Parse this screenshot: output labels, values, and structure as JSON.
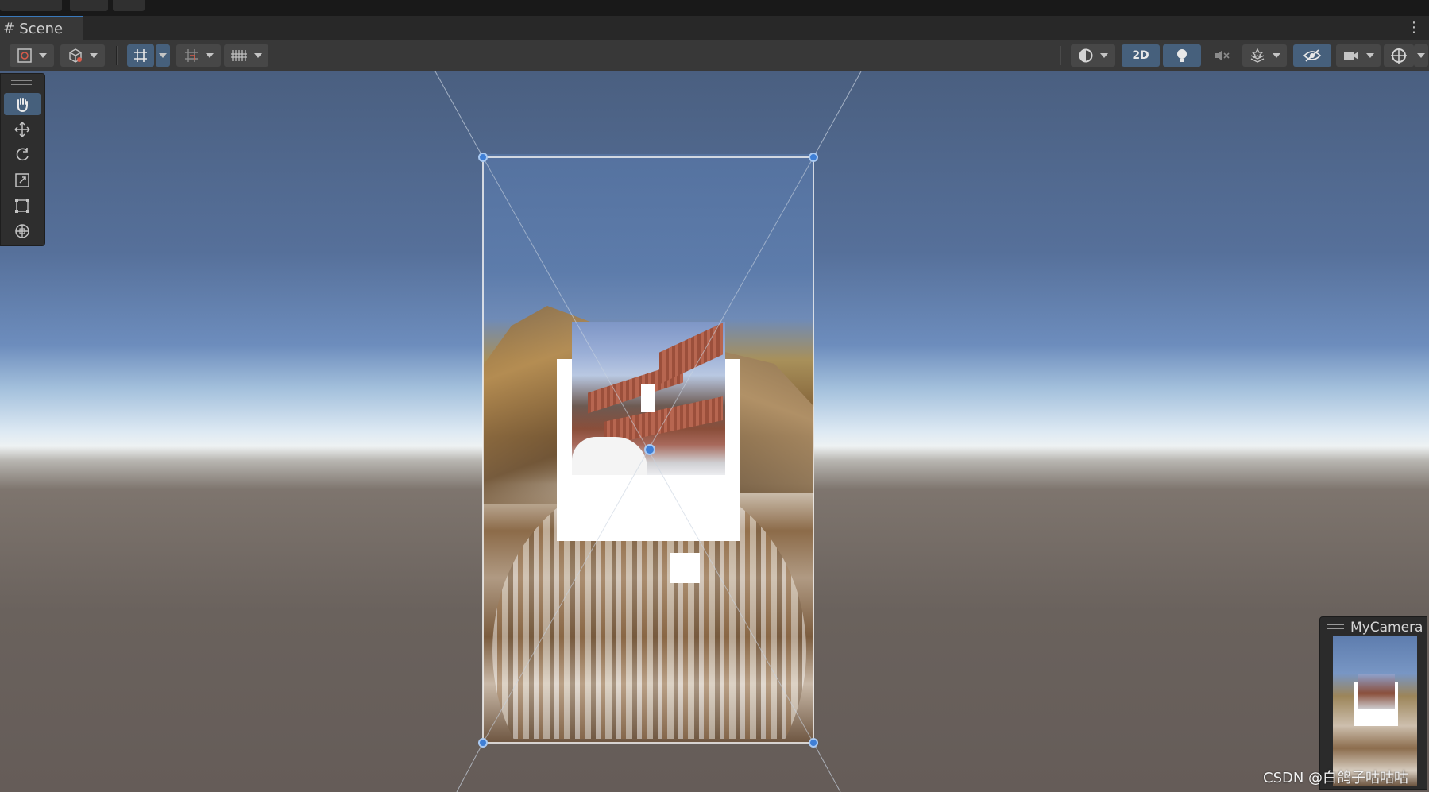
{
  "window": {
    "scene_tab_label": "Scene"
  },
  "toolbar": {
    "mode_2d_label": "2D",
    "icons": [
      "gizmo-draw-mode-icon",
      "render-mode-icon",
      "grid-snapping-icon",
      "increment-snapping-icon",
      "grid-visibility-icon",
      "shading-mode-icon",
      "2d-toggle",
      "lighting-toggle-icon",
      "audio-toggle-icon",
      "effects-icon",
      "hidden-objects-icon",
      "camera-settings-icon",
      "gizmos-icon"
    ]
  },
  "tools": {
    "items": [
      "hand-tool",
      "move-tool",
      "rotate-tool",
      "scale-tool",
      "rect-tool",
      "transform-tool"
    ],
    "active": "hand-tool"
  },
  "camera_preview": {
    "title": "MyCamera"
  },
  "watermark": {
    "text": "CSDN @白鸽子咕咕咕"
  },
  "colors": {
    "accent": "#46607c",
    "handle": "#3f7fd6",
    "tab_border": "#3a79bb"
  }
}
